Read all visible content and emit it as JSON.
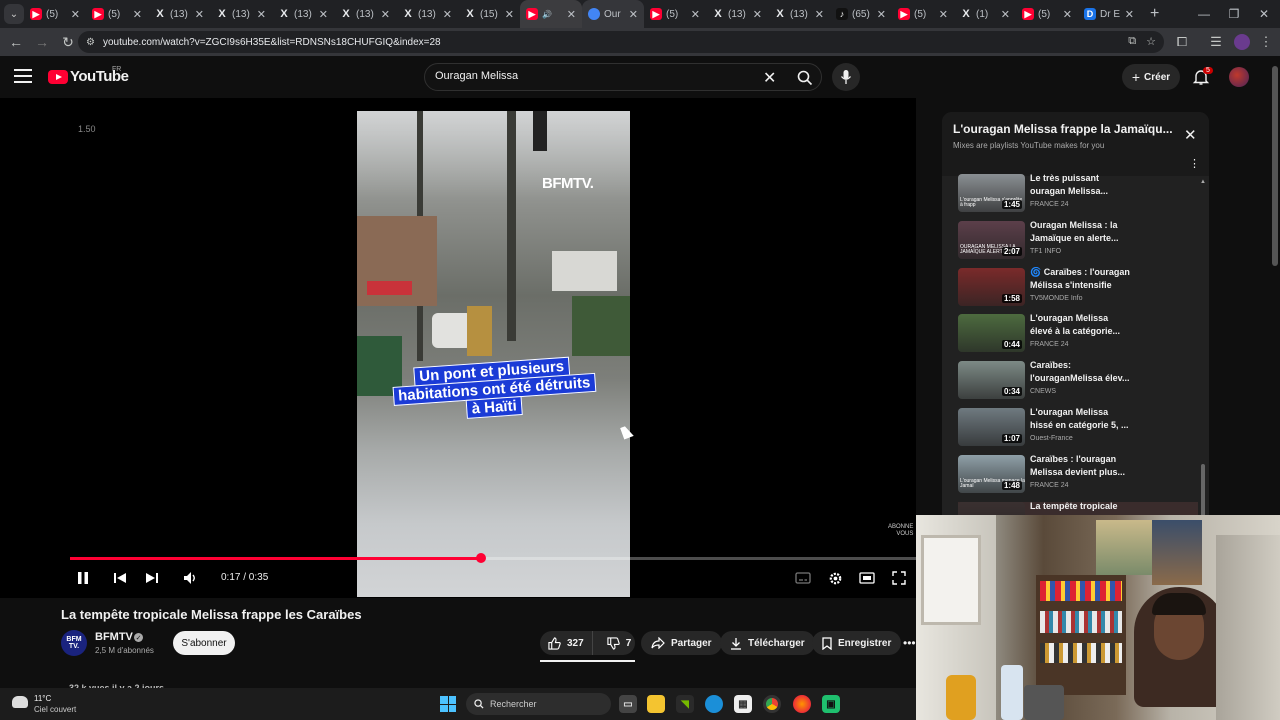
{
  "browser": {
    "tabs": [
      {
        "icon": "youtube-icon",
        "title": "(5) ",
        "type": "yt"
      },
      {
        "icon": "youtube-icon",
        "title": "(5) ",
        "type": "yt"
      },
      {
        "icon": "x-icon",
        "title": "(13)",
        "type": "x"
      },
      {
        "icon": "x-icon",
        "title": "(13)",
        "type": "x"
      },
      {
        "icon": "x-icon",
        "title": "(13)",
        "type": "x"
      },
      {
        "icon": "x-icon",
        "title": "(13)",
        "type": "x"
      },
      {
        "icon": "x-icon",
        "title": "(13)",
        "type": "x"
      },
      {
        "icon": "x-icon",
        "title": "(15)",
        "type": "x"
      },
      {
        "icon": "youtube-icon",
        "title": "",
        "type": "yt"
      },
      {
        "icon": "google-icon",
        "title": "Our",
        "type": "g"
      },
      {
        "icon": "youtube-icon",
        "title": "(5) ",
        "type": "yt"
      },
      {
        "icon": "x-icon",
        "title": "(13)",
        "type": "x"
      },
      {
        "icon": "x-icon",
        "title": "(13)",
        "type": "x"
      },
      {
        "icon": "tiktok-icon",
        "title": "(65)",
        "type": "tt"
      },
      {
        "icon": "youtube-icon",
        "title": "(5) ",
        "type": "yt"
      },
      {
        "icon": "x-icon",
        "title": "(1) ",
        "type": "x"
      },
      {
        "icon": "youtube-icon",
        "title": "(5) ",
        "type": "yt"
      },
      {
        "icon": "docs-icon",
        "title": "Dr E",
        "type": "d"
      }
    ],
    "url": "youtube.com/watch?v=ZGCI9s6H35E&list=RDNSNs18CHUFGIQ&index=28"
  },
  "youtube": {
    "logo_text": "YouTube",
    "logo_region": "FR",
    "search_value": "Ouragan Melissa",
    "create_label": "Créer",
    "notification_count": "5"
  },
  "player": {
    "speed_label": "1.50",
    "watermark": "BFMTV.",
    "caption": "Un pont et plusieurs habitations ont été détruits à Haïti",
    "subscribe_watermark_line1": "ABONNE",
    "subscribe_watermark_line2": "VOUS",
    "current_time": "0:17",
    "duration": "0:35",
    "time_text": "0:17 / 0:35",
    "progress": 0.486
  },
  "video": {
    "title": "La tempête tropicale Melissa frappe les Caraïbes",
    "channel_avatar_text": "BFM TV.",
    "channel": "BFMTV",
    "subscribers": "2,5 M d'abonnés",
    "subscribe_label": "S'abonner",
    "likes": "327",
    "dislikes": "7",
    "share_label": "Partager",
    "download_label": "Télécharger",
    "save_label": "Enregistrer",
    "views_line": "32 k vues  il y a 2 jours"
  },
  "playlist": {
    "title": "L'ouragan Melissa frappe la Jamaïqu...",
    "subtitle": "Mixes are playlists YouTube makes for you",
    "items": [
      {
        "title1": "Le très puissant",
        "title2": "ouragan Melissa...",
        "channel": "FRANCE 24",
        "duration": "1:45",
        "thumb_text": "L'ouragan Melissa s'apprête à frapp",
        "thumb_bg": "#8a8f93"
      },
      {
        "title1": "Ouragan Melissa : la",
        "title2": "Jamaïque en alerte...",
        "channel": "TF1 INFO",
        "duration": "2:07",
        "thumb_text": "OURAGAN MELISSA LA JAMAÏQUE ALERTE MAXI",
        "thumb_bg": "#5c3f4a"
      },
      {
        "title1": "🌀 Caraïbes : l'ouragan",
        "title2": "Mélissa s'intensifie",
        "channel": "TV5MONDE Info",
        "duration": "1:58",
        "thumb_text": "",
        "thumb_bg": "#7a2a2a"
      },
      {
        "title1": "L'ouragan Melissa",
        "title2": "élevé à la catégorie...",
        "channel": "FRANCE 24",
        "duration": "0:44",
        "thumb_text": "",
        "thumb_bg": "#4d6b3f"
      },
      {
        "title1": "Caraïbes:",
        "title2": "l'ouraganMelissa élev...",
        "channel": "CNEWS",
        "duration": "0:34",
        "thumb_text": "",
        "thumb_bg": "#7d8a86"
      },
      {
        "title1": "L'ouragan Melissa",
        "title2": "hissé en catégorie 5, ...",
        "channel": "Ouest-France",
        "duration": "1:07",
        "thumb_text": "",
        "thumb_bg": "#6f7a80"
      },
      {
        "title1": "Caraïbes : l'ouragan",
        "title2": "Melissa devient plus...",
        "channel": "FRANCE 24",
        "duration": "1:48",
        "thumb_text": "L'ouragan Melissa menace la Jamaï",
        "thumb_bg": "#8fa0a8"
      },
      {
        "title1": "La tempête tropicale",
        "title2": "",
        "channel": "",
        "duration": "",
        "thumb_text": "",
        "thumb_bg": "#3a3030"
      }
    ]
  },
  "taskbar": {
    "temperature": "11°C",
    "weather": "Ciel couvert",
    "search_placeholder": "Rechercher"
  }
}
